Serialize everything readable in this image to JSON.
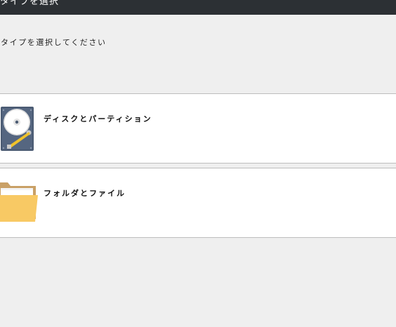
{
  "window": {
    "title": "タイプを選択"
  },
  "instruction": "タイプを選択してください",
  "options": [
    {
      "label": "ディスクとパーティション",
      "icon": "hard-disk-icon"
    },
    {
      "label": "フォルダとファイル",
      "icon": "folder-icon"
    }
  ],
  "colors": {
    "title_bar": "#2c3034",
    "background": "#efefef",
    "card": "#ffffff",
    "card_border": "#bdbdbd"
  }
}
